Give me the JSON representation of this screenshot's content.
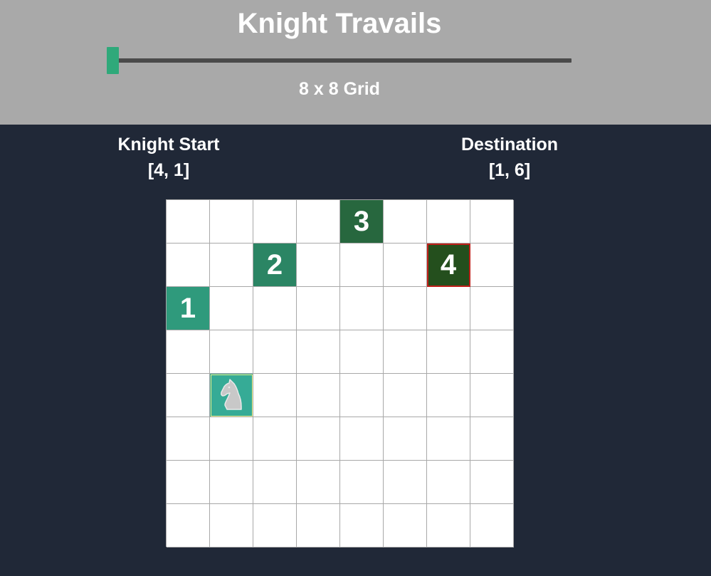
{
  "app": {
    "title": "Knight Travails",
    "grid_size_label": "8 x 8 Grid",
    "grid_size_value": 8
  },
  "slider": {
    "min": 8,
    "value": 8
  },
  "start": {
    "label": "Knight Start",
    "coord": "[4, 1]"
  },
  "destination": {
    "label": "Destination",
    "coord": "[1, 6]"
  },
  "board": {
    "rows": 8,
    "cols": 8,
    "knight_position": [
      4,
      1
    ],
    "path": [
      {
        "step": "1",
        "row": 2,
        "col": 0,
        "color": "#2f9a7c"
      },
      {
        "step": "2",
        "row": 1,
        "col": 2,
        "color": "#2b8564"
      },
      {
        "step": "3",
        "row": 0,
        "col": 4,
        "color": "#27673e"
      },
      {
        "step": "4",
        "row": 1,
        "col": 6,
        "color": "#244f1d"
      }
    ],
    "knight_icon": "knight-icon"
  },
  "colors": {
    "header_bg": "#a9a9a9",
    "page_bg": "#202837",
    "accent": "#2fa97a",
    "knight_cell": "#36ab96",
    "destination_border": "#c0201a"
  }
}
